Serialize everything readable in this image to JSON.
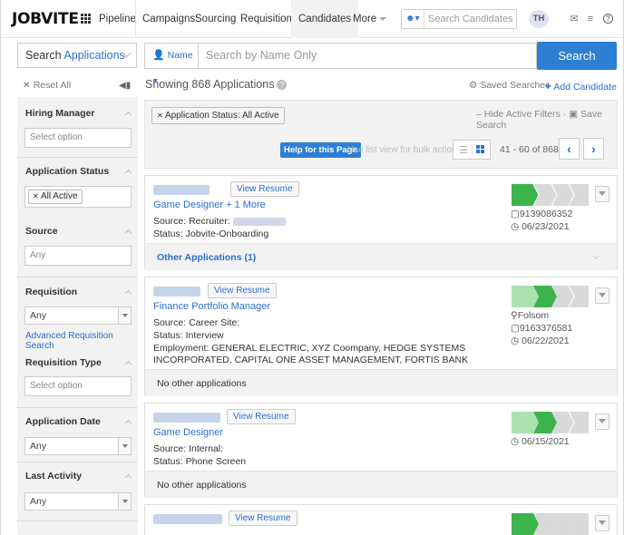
{
  "logo": "JOBVITE",
  "nav": {
    "items": [
      "Pipeline",
      "Campaigns",
      "Sourcing",
      "Requisitions",
      "Candidates",
      "More"
    ],
    "active": "Candidates",
    "search_candidates_placeholder": "Search Candidates",
    "avatar_initials": "TH"
  },
  "search": {
    "mode_prefix": "Search",
    "mode_value": "Applications",
    "field_label": "Name",
    "placeholder": "Search by Name Only",
    "button": "Search"
  },
  "toolbar": {
    "reset_all": "Reset All",
    "showing": "Showing 868 Applications",
    "saved_searches": "Saved Searches",
    "add_candidate": "Add Candidate"
  },
  "filters": [
    {
      "label": "Hiring Manager",
      "control": "input",
      "value": "Select option"
    },
    {
      "label": "Application Status",
      "control": "tag",
      "value": "All Active"
    },
    {
      "label": "Source",
      "control": "input",
      "value": "Any"
    },
    {
      "label": "Requisition",
      "control": "select",
      "value": "Any",
      "link": "Advanced Requisition Search"
    },
    {
      "label": "Requisition Type",
      "control": "input",
      "value": "Select option"
    },
    {
      "label": "Application Date",
      "control": "select",
      "value": "Any"
    },
    {
      "label": "Last Activity",
      "control": "select",
      "value": "Any"
    }
  ],
  "filterbar": {
    "active_filter": "Application Status: All Active",
    "hide_active": "Hide Active Filters",
    "save_search": "Save Search",
    "help": "Help for this Page",
    "list_hint": "Use list view for bulk actions",
    "pagination": "41 - 60 of 868"
  },
  "colors": {
    "accent": "#2d7fd3",
    "pipeline_done": "#3cb44b",
    "pipeline_light": "#a9e2b0",
    "pipeline_todo": "#d9d9d9"
  },
  "cards": [
    {
      "title": "Game Designer + 1 More",
      "source_label": "Source: Recruiter:",
      "status": "Status: Jobvite-Onboarding",
      "phone": "9139086352",
      "date": "06/23/2021",
      "footer": "Other Applications (1)",
      "view_resume": "View Resume",
      "stage": 1
    },
    {
      "title": "Finance Portfolio Manager",
      "source_label": "Source: Career Site:",
      "status": "Status: Interview",
      "employment": "Employment: GENERAL ELECTRIC, XYZ Coompany, HEDGE SYSTEMS INCORPORATED, CAPITAL ONE ASSET MANAGEMENT, FORTIS BANK",
      "location": "Folsom",
      "phone": "9163376581",
      "date": "06/22/2021",
      "footer": "No other applications",
      "view_resume": "View Resume",
      "stage": 2
    },
    {
      "title": "Game Designer",
      "source_label": "Source: Internal:",
      "status": "Status: Phone Screen",
      "date": "06/15/2021",
      "footer": "No other applications",
      "view_resume": "View Resume",
      "stage": 2
    },
    {
      "view_resume": "View Resume",
      "stage": 1
    }
  ]
}
